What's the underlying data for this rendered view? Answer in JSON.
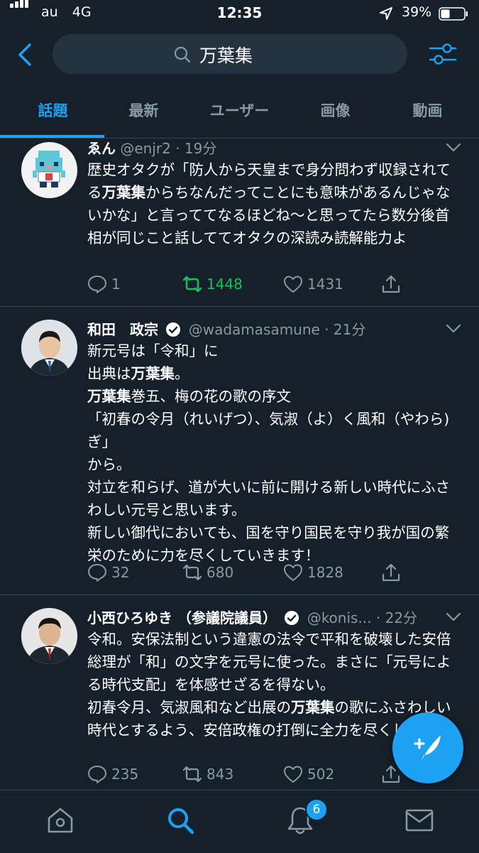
{
  "status_bar": {
    "carrier": "au",
    "network": "4G",
    "time": "12:35",
    "battery_pct": "39%",
    "battery_level": 0.39
  },
  "header": {
    "query": "万葉集",
    "icons": [
      "back-chevron-icon",
      "search-icon",
      "filter-sliders-icon"
    ]
  },
  "tabs": {
    "items": [
      "話題",
      "最新",
      "ユーザー",
      "画像",
      "動画"
    ],
    "active_index": 0
  },
  "tweets": [
    {
      "name": "ゑん",
      "handle": "@enjr2",
      "time": "19分",
      "verified": false,
      "body_parts": [
        {
          "t": "歴史オタクが「防人から天皇まで身分問わず収録されてる",
          "b": false
        },
        {
          "t": "万葉集",
          "b": true
        },
        {
          "t": "からちなんだってことにも意味があるんじゃないかな」と言っててなるほどね〜と思ってたら数分後首相が同じこと話しててオタクの深読み読解能力よ",
          "b": false
        }
      ],
      "replies": "1",
      "retweets": "1448",
      "retweeted": true,
      "likes": "1431"
    },
    {
      "name": "和田　政宗",
      "handle": "@wadamasamune",
      "time": "21分",
      "verified": true,
      "body_parts": [
        {
          "t": "新元号は「令和」に\n出典は",
          "b": false
        },
        {
          "t": "万葉集",
          "b": true
        },
        {
          "t": "。\n",
          "b": false
        },
        {
          "t": "万葉集",
          "b": true
        },
        {
          "t": "巻五、梅の花の歌の序文\n「初春の令月（れいげつ）、気淑（よ）く風和（やわら)ぎ」\nから。\n対立を和らげ、道が大いに前に開ける新しい時代にふさわしい元号と思います。\n新しい御代においても、国を守り国民を守り我が国の繁栄のために力を尽くしていきます！",
          "b": false
        }
      ],
      "replies": "32",
      "retweets": "680",
      "retweeted": false,
      "likes": "1828"
    },
    {
      "name": "小西ひろゆき （参議院議員）",
      "handle": "@konis...",
      "time": "22分",
      "verified": true,
      "body_parts": [
        {
          "t": "令和。安保法制という違憲の法令で平和を破壊した安倍総理が「和」の文字を元号に使った。まさに「元号による時代支配」を体感せざるを得ない。\n初春令月、気淑風和など出展の",
          "b": false
        },
        {
          "t": "万葉集",
          "b": true
        },
        {
          "t": "の歌にふさわしい時代とするよう、安倍政権の打倒に全力を尽くします。",
          "b": false
        }
      ],
      "replies": "235",
      "retweets": "843",
      "retweeted": false,
      "likes": "502"
    }
  ],
  "bottom_nav": {
    "items": [
      "home-icon",
      "search-icon",
      "notifications-icon",
      "messages-icon"
    ],
    "active": "search-icon",
    "notification_badge": "6"
  },
  "compose_button": "compose-tweet-icon",
  "colors": {
    "background": "#15202b",
    "accent": "#1da1f2",
    "muted": "#8899a6",
    "retweet_active": "#17bf63",
    "divider": "#38444d"
  }
}
